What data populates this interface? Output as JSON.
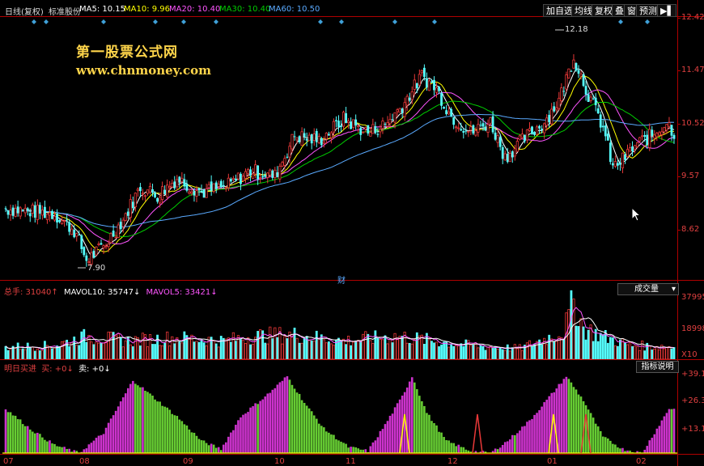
{
  "header": {
    "period": "日线(复权)",
    "standard": "标准股份",
    "ma5": "MA5: 10.15",
    "ma10": "MA10: 9.96",
    "ma20": "MA20: 10.40",
    "ma30": "MA30: 10.40",
    "ma60": "MA60: 10.50"
  },
  "toolbar": {
    "add_watch": "加自选",
    "equal_line": "均线",
    "restore_right": "复权",
    "overlay": "叠",
    "window": "窗",
    "forecast": "预测"
  },
  "watermark": {
    "title": "第一股票公式网",
    "url": "www.chnmoney.com"
  },
  "price_axis": {
    "labels": [
      "12.42",
      "11.47",
      "10.52",
      "9.57",
      "8.62"
    ]
  },
  "annotations": {
    "high": "12.18",
    "low": "7.90",
    "cai": "财"
  },
  "volume_panel": {
    "total": "总手: 31040",
    "mavol10": "MAVOL10: 35747",
    "mavol5": "MAVOL5: 33421",
    "selector": "成交量",
    "axis": [
      "37995",
      "18998",
      "X10"
    ]
  },
  "indicator_panel": {
    "name": "明日买进",
    "buy": "买: +0",
    "sell": "卖: +0",
    "help": "指标说明",
    "axis": [
      "+39.18",
      "+26.32",
      "+13.16"
    ]
  },
  "time_axis": [
    "07",
    "08",
    "09",
    "10",
    "11",
    "12",
    "01",
    "02"
  ],
  "colors": {
    "up": "#e83838",
    "down": "#54fcfc",
    "ma5": "#ffffff",
    "ma10": "#ffff00",
    "ma20": "#ff55ff",
    "ma30": "#00cc00",
    "ma60": "#5aaaff",
    "axis": "#b00000",
    "buy_bar": "#cc33cc",
    "sell_bar": "#66cc33"
  },
  "chart_data": {
    "type": "candlestick",
    "ylim": [
      7.6,
      12.42
    ],
    "price_anchors": [
      [
        0,
        8.9
      ],
      [
        10,
        8.85
      ],
      [
        20,
        8.8
      ],
      [
        28,
        8.5
      ],
      [
        33,
        7.95
      ],
      [
        40,
        8.2
      ],
      [
        48,
        8.7
      ],
      [
        55,
        9.3
      ],
      [
        62,
        9.15
      ],
      [
        70,
        9.45
      ],
      [
        80,
        9.2
      ],
      [
        90,
        9.3
      ],
      [
        100,
        9.6
      ],
      [
        110,
        9.5
      ],
      [
        118,
        10.25
      ],
      [
        128,
        10.15
      ],
      [
        138,
        10.55
      ],
      [
        148,
        10.3
      ],
      [
        155,
        10.45
      ],
      [
        162,
        10.8
      ],
      [
        170,
        11.35
      ],
      [
        176,
        11.1
      ],
      [
        182,
        10.6
      ],
      [
        190,
        10.3
      ],
      [
        198,
        10.5
      ],
      [
        204,
        9.85
      ],
      [
        212,
        10.2
      ],
      [
        220,
        10.5
      ],
      [
        226,
        10.9
      ],
      [
        232,
        11.7
      ],
      [
        238,
        11.0
      ],
      [
        244,
        10.4
      ],
      [
        248,
        9.65
      ],
      [
        252,
        9.8
      ],
      [
        258,
        10.1
      ],
      [
        264,
        10.25
      ],
      [
        270,
        10.5
      ],
      [
        273,
        10.3
      ]
    ],
    "volume_ylim": [
      0,
      40000
    ],
    "volume_anchors": [
      [
        0,
        8000
      ],
      [
        20,
        9000
      ],
      [
        33,
        15000
      ],
      [
        50,
        12000
      ],
      [
        70,
        14000
      ],
      [
        90,
        12000
      ],
      [
        100,
        15000
      ],
      [
        118,
        16000
      ],
      [
        138,
        12000
      ],
      [
        160,
        15000
      ],
      [
        175,
        12000
      ],
      [
        190,
        9000
      ],
      [
        210,
        7000
      ],
      [
        228,
        18000
      ],
      [
        232,
        37995
      ],
      [
        236,
        20000
      ],
      [
        244,
        15000
      ],
      [
        255,
        9000
      ],
      [
        273,
        8000
      ]
    ],
    "indicator_ylim": [
      0,
      40
    ],
    "indicator_anchors": [
      [
        0,
        22
      ],
      [
        10,
        12
      ],
      [
        20,
        4
      ],
      [
        30,
        0
      ],
      [
        40,
        10
      ],
      [
        52,
        36
      ],
      [
        60,
        28
      ],
      [
        70,
        18
      ],
      [
        80,
        6
      ],
      [
        88,
        2
      ],
      [
        96,
        18
      ],
      [
        108,
        30
      ],
      [
        115,
        38
      ],
      [
        122,
        25
      ],
      [
        130,
        12
      ],
      [
        140,
        3
      ],
      [
        148,
        1
      ],
      [
        155,
        14
      ],
      [
        162,
        28
      ],
      [
        166,
        38
      ],
      [
        172,
        20
      ],
      [
        180,
        6
      ],
      [
        190,
        1
      ],
      [
        198,
        0
      ],
      [
        205,
        6
      ],
      [
        214,
        16
      ],
      [
        225,
        32
      ],
      [
        229,
        38
      ],
      [
        236,
        26
      ],
      [
        244,
        8
      ],
      [
        252,
        2
      ],
      [
        260,
        0
      ],
      [
        266,
        12
      ],
      [
        271,
        22
      ],
      [
        273,
        22
      ]
    ]
  }
}
